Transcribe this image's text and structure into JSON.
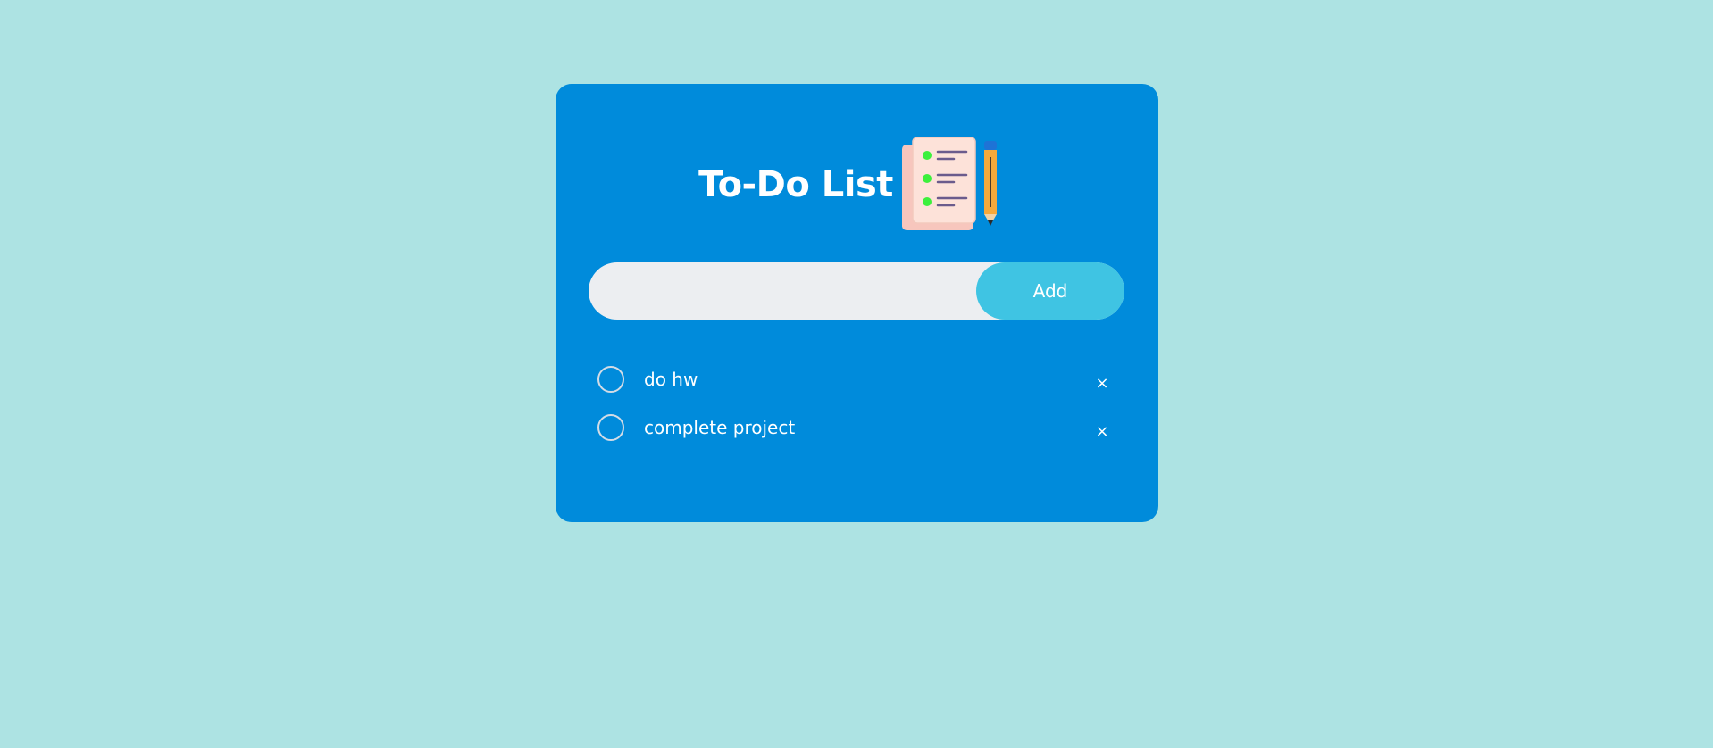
{
  "app": {
    "title": "To-Do List",
    "logo_icon": "checklist-with-pencil-icon"
  },
  "input": {
    "value": "",
    "placeholder": "",
    "add_label": "Add"
  },
  "tasks": [
    {
      "text": "do hw",
      "checked": false,
      "delete_label": "×"
    },
    {
      "text": "complete project",
      "checked": false,
      "delete_label": "×"
    }
  ],
  "colors": {
    "page_background": "#ade3e3",
    "card_background": "#008bdb",
    "input_background": "#eceef1",
    "add_button": "#3fc4e3",
    "text": "#ffffff"
  }
}
